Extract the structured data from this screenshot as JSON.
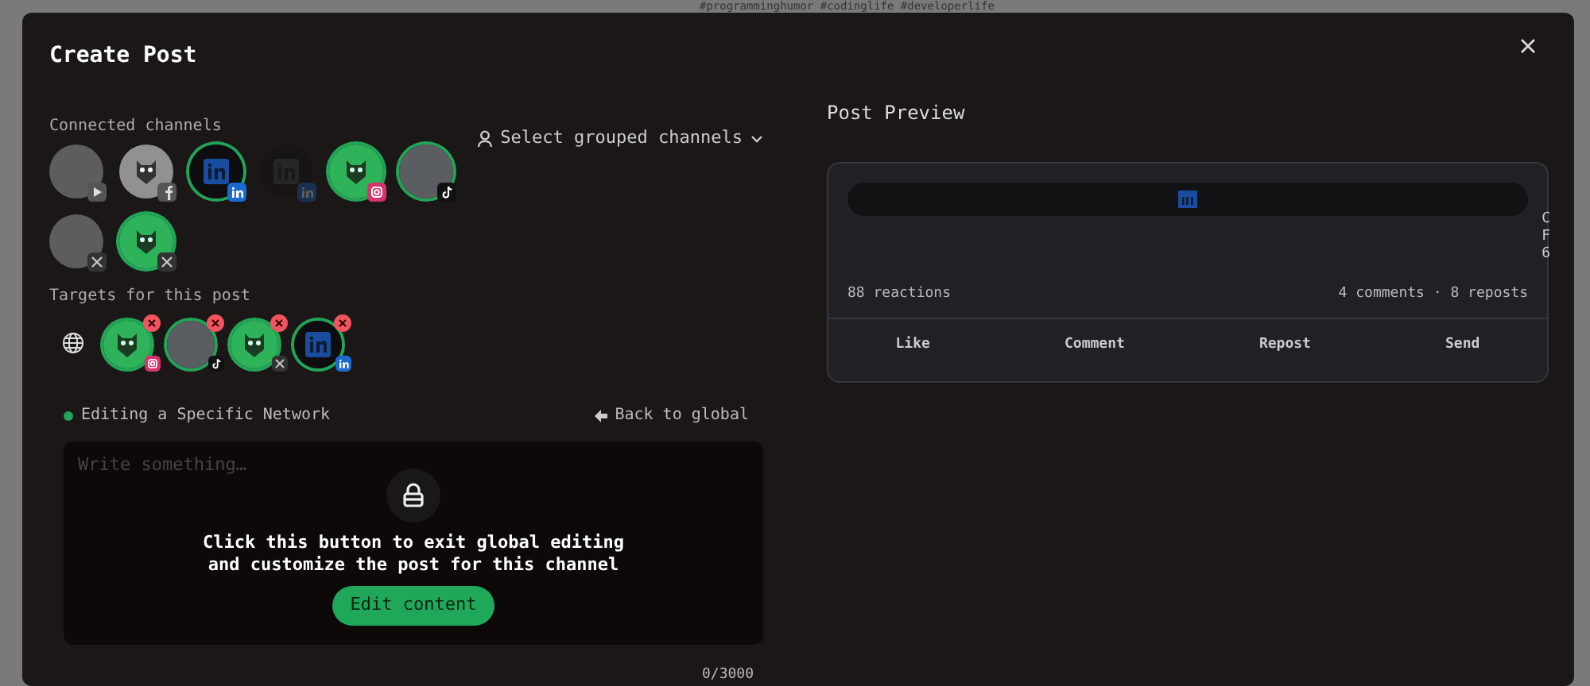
{
  "background_text": "#programminghumor #codinglife #developerlife",
  "modal": {
    "title": "Create Post"
  },
  "connected_channels": {
    "label": "Connected channels",
    "items": [
      {
        "avatar": {
          "kind": "photo"
        },
        "badge": {
          "kind": "youtube"
        },
        "selected": false,
        "disabled": false
      },
      {
        "avatar": {
          "kind": "mascot"
        },
        "badge": {
          "kind": "facebook"
        },
        "selected": false,
        "disabled": false
      },
      {
        "avatar": {
          "kind": "linkedin"
        },
        "badge": {
          "kind": "linkedin"
        },
        "selected": true,
        "disabled": false
      },
      {
        "avatar": {
          "kind": "linkedin"
        },
        "badge": {
          "kind": "linkedin"
        },
        "selected": false,
        "disabled": true
      },
      {
        "avatar": {
          "kind": "mascot"
        },
        "badge": {
          "kind": "instagram"
        },
        "selected": true,
        "disabled": false
      },
      {
        "avatar": {
          "kind": "photo"
        },
        "badge": {
          "kind": "tiktok"
        },
        "selected": true,
        "disabled": false
      },
      {
        "avatar": {
          "kind": "photo"
        },
        "badge": {
          "kind": "x"
        },
        "selected": false,
        "disabled": false
      },
      {
        "avatar": {
          "kind": "mascot"
        },
        "badge": {
          "kind": "x"
        },
        "selected": true,
        "disabled": false
      }
    ]
  },
  "group_select": {
    "label": "Select grouped channels"
  },
  "targets": {
    "label": "Targets for this post",
    "items": [
      {
        "avatar": {
          "kind": "mascot"
        },
        "badge": {
          "kind": "instagram"
        }
      },
      {
        "avatar": {
          "kind": "photo"
        },
        "badge": {
          "kind": "tiktok"
        }
      },
      {
        "avatar": {
          "kind": "mascot"
        },
        "badge": {
          "kind": "x"
        }
      },
      {
        "avatar": {
          "kind": "linkedin"
        },
        "badge": {
          "kind": "linkedin"
        }
      }
    ]
  },
  "editor": {
    "mode": "Editing a Specific Network",
    "back_link": "Back to global",
    "placeholder": "Write something…",
    "lock_message": "Click this button to exit global editing and customize the post for this channel",
    "edit_button": "Edit content",
    "counter": "0/3000"
  },
  "preview": {
    "title": "Post Preview",
    "overflow_text": [
      "C",
      "F",
      "6"
    ],
    "reactions": "88 reactions",
    "stats": "4 comments · 8 reposts",
    "actions": [
      "Like",
      "Comment",
      "Repost",
      "Send"
    ]
  }
}
